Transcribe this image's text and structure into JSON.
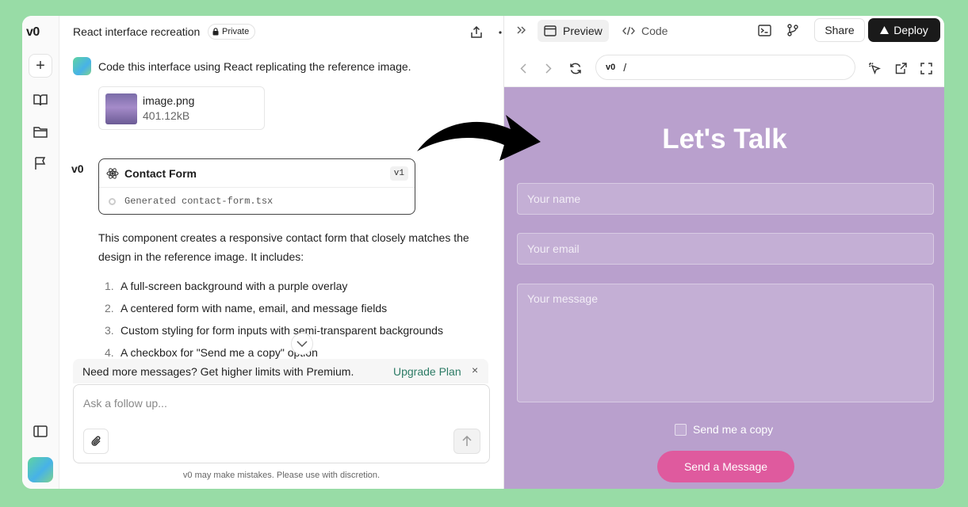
{
  "sidebar": {
    "logo_text": "v0",
    "new_icon": "plus-icon",
    "icons": [
      "book-icon",
      "folder-icon",
      "flag-icon",
      "panel-toggle-icon"
    ]
  },
  "chat": {
    "title": "React interface recreation",
    "visibility": "Private",
    "header_icons": [
      "share-upload-icon",
      "more-icon"
    ],
    "user_message": "Code this interface using React replicating the reference image.",
    "attachment": {
      "name": "image.png",
      "size": "401.12kB"
    },
    "assistant_mark": "v0",
    "card": {
      "title": "Contact Form",
      "version": "v1",
      "status": "Generated contact-form.tsx"
    },
    "description": "This component creates a responsive contact form that closely matches the design in the reference image. It includes:",
    "steps": [
      {
        "num": "1.",
        "text": "A full-screen background with a purple overlay"
      },
      {
        "num": "2.",
        "text": "A centered form with name, email, and message fields"
      },
      {
        "num": "3.",
        "text": "Custom styling for form inputs with semi-transparent backgrounds"
      },
      {
        "num": "4.",
        "text": "A checkbox for \"Send me a copy\" option"
      }
    ],
    "promo": {
      "text": "Need more messages? Get higher limits with Premium.",
      "link": "Upgrade Plan",
      "close": "×"
    },
    "composer_placeholder": "Ask a follow up...",
    "disclaimer": "v0 may make mistakes. Please use with discretion."
  },
  "preview": {
    "tabs": [
      {
        "label": "Preview",
        "icon": "browser-icon",
        "active": true
      },
      {
        "label": "Code",
        "icon": "code-icon",
        "active": false
      }
    ],
    "share_label": "Share",
    "deploy_label": "Deploy",
    "url_logo": "v0",
    "url_path": "/",
    "form": {
      "title": "Let's Talk",
      "name_placeholder": "Your name",
      "email_placeholder": "Your email",
      "message_placeholder": "Your message",
      "checkbox_label": "Send me a copy",
      "submit_label": "Send a Message"
    },
    "colors": {
      "background": "#b9a0cd",
      "button": "#df5a9e",
      "deploy": "#1a1a1a",
      "page": "#98dca6",
      "link": "#2c7b65"
    }
  }
}
